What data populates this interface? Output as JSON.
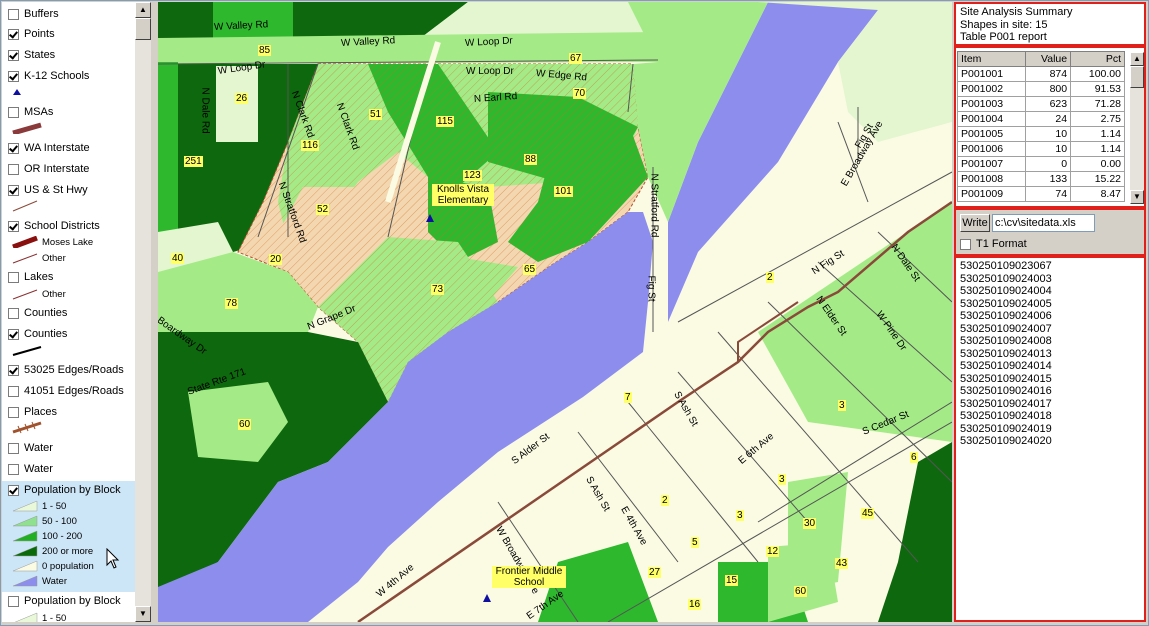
{
  "legend": {
    "layers": [
      {
        "label": "Buffers",
        "checked": false
      },
      {
        "label": "Points",
        "checked": true
      },
      {
        "label": "States",
        "checked": true
      },
      {
        "label": "K-12 Schools",
        "checked": true
      },
      {
        "label": "MSAs",
        "checked": false
      },
      {
        "label": "WA Interstate",
        "checked": true
      },
      {
        "label": "OR Interstate",
        "checked": false
      },
      {
        "label": "US & St Hwy",
        "checked": true
      },
      {
        "label": "School Districts",
        "checked": true
      },
      {
        "label": "Lakes",
        "checked": false
      },
      {
        "label": "Counties",
        "checked": false
      },
      {
        "label": "Counties",
        "checked": true
      },
      {
        "label": "53025 Edges/Roads",
        "checked": true
      },
      {
        "label": "41051 Edges/Roads",
        "checked": false
      },
      {
        "label": "Places",
        "checked": false
      },
      {
        "label": "Water",
        "checked": false
      },
      {
        "label": "Water",
        "checked": false
      },
      {
        "label": "Population by Block",
        "checked": true
      },
      {
        "label": "Population by Block",
        "checked": false
      }
    ],
    "school_district_items": [
      "Moses Lake",
      "Other"
    ],
    "lakes_items": [
      "Other"
    ],
    "population_classes": [
      {
        "label": "1 - 50",
        "color": "#e8f8d8"
      },
      {
        "label": "50 - 100",
        "color": "#8fe08f"
      },
      {
        "label": "100 - 200",
        "color": "#22b022"
      },
      {
        "label": "200 or more",
        "color": "#0a6a0a"
      },
      {
        "label": "0 population",
        "color": "#fbfbe4"
      },
      {
        "label": "Water",
        "color": "#8d8dee"
      }
    ],
    "population2_classes": [
      {
        "label": "1 - 50",
        "color": "#e8f8d8"
      }
    ]
  },
  "map": {
    "colors": {
      "water": "#8d8dee",
      "light": "#fbfbe4",
      "lightgreen": "#a4eb88",
      "midgreen": "#2eb82e",
      "darkgreen": "#0e680e",
      "palegreen": "#e4f6cf",
      "hatch": "#f3d7b0"
    },
    "roads": [
      "W Valley Rd",
      "W Valley Rd",
      "W Loop Dr",
      "W Loop Dr",
      "W Loop Dr",
      "W Edge Rd",
      "N Earl Rd",
      "N Dale Rd",
      "N Clark Rd",
      "N Clark Rd",
      "N Stratford Rd",
      "N Stratford Rd",
      "Fig St",
      "Fig St",
      "E Broadway Ave",
      "N Fig St",
      "N Dale St",
      "N Elder St",
      "W Pine Dr",
      "N Grape Dr",
      "Boardway Dr",
      "State Rte 171",
      "S Alder St",
      "S Ash St",
      "S Ash St",
      "E 4th Ave",
      "E 6th Ave",
      "S Cedar St",
      "W Broadway Ave",
      "W 4th Ave",
      "E 7th Ave"
    ],
    "block_values": [
      "85",
      "26",
      "51",
      "116",
      "115",
      "67",
      "70",
      "123",
      "88",
      "101",
      "52",
      "20",
      "40",
      "65",
      "73",
      "78",
      "2",
      "7",
      "60",
      "3",
      "3",
      "6",
      "2",
      "3",
      "30",
      "45",
      "5",
      "12",
      "27",
      "15",
      "43",
      "16",
      "60",
      "251"
    ],
    "schools": [
      "Knolls Vista Elementary",
      "Frontier Middle School"
    ]
  },
  "summary": {
    "line1": "Site Analysis Summary",
    "line2": "Shapes in site: 15",
    "line3": "Table P001 report"
  },
  "table": {
    "headers": [
      "Item",
      "Value",
      "Pct"
    ],
    "rows": [
      [
        "P001001",
        "874",
        "100.00"
      ],
      [
        "P001002",
        "800",
        "91.53"
      ],
      [
        "P001003",
        "623",
        "71.28"
      ],
      [
        "P001004",
        "24",
        "2.75"
      ],
      [
        "P001005",
        "10",
        "1.14"
      ],
      [
        "P001006",
        "10",
        "1.14"
      ],
      [
        "P001007",
        "0",
        "0.00"
      ],
      [
        "P001008",
        "133",
        "15.22"
      ],
      [
        "P001009",
        "74",
        "8.47"
      ]
    ]
  },
  "write": {
    "button": "Write",
    "path": "c:\\cv\\sitedata.xls",
    "t1_label": "T1 Format"
  },
  "block_ids": [
    "530250109023067",
    "530250109024003",
    "530250109024004",
    "530250109024005",
    "530250109024006",
    "530250109024007",
    "530250109024008",
    "530250109024013",
    "530250109024014",
    "530250109024015",
    "530250109024016",
    "530250109024017",
    "530250109024018",
    "530250109024019",
    "530250109024020"
  ]
}
